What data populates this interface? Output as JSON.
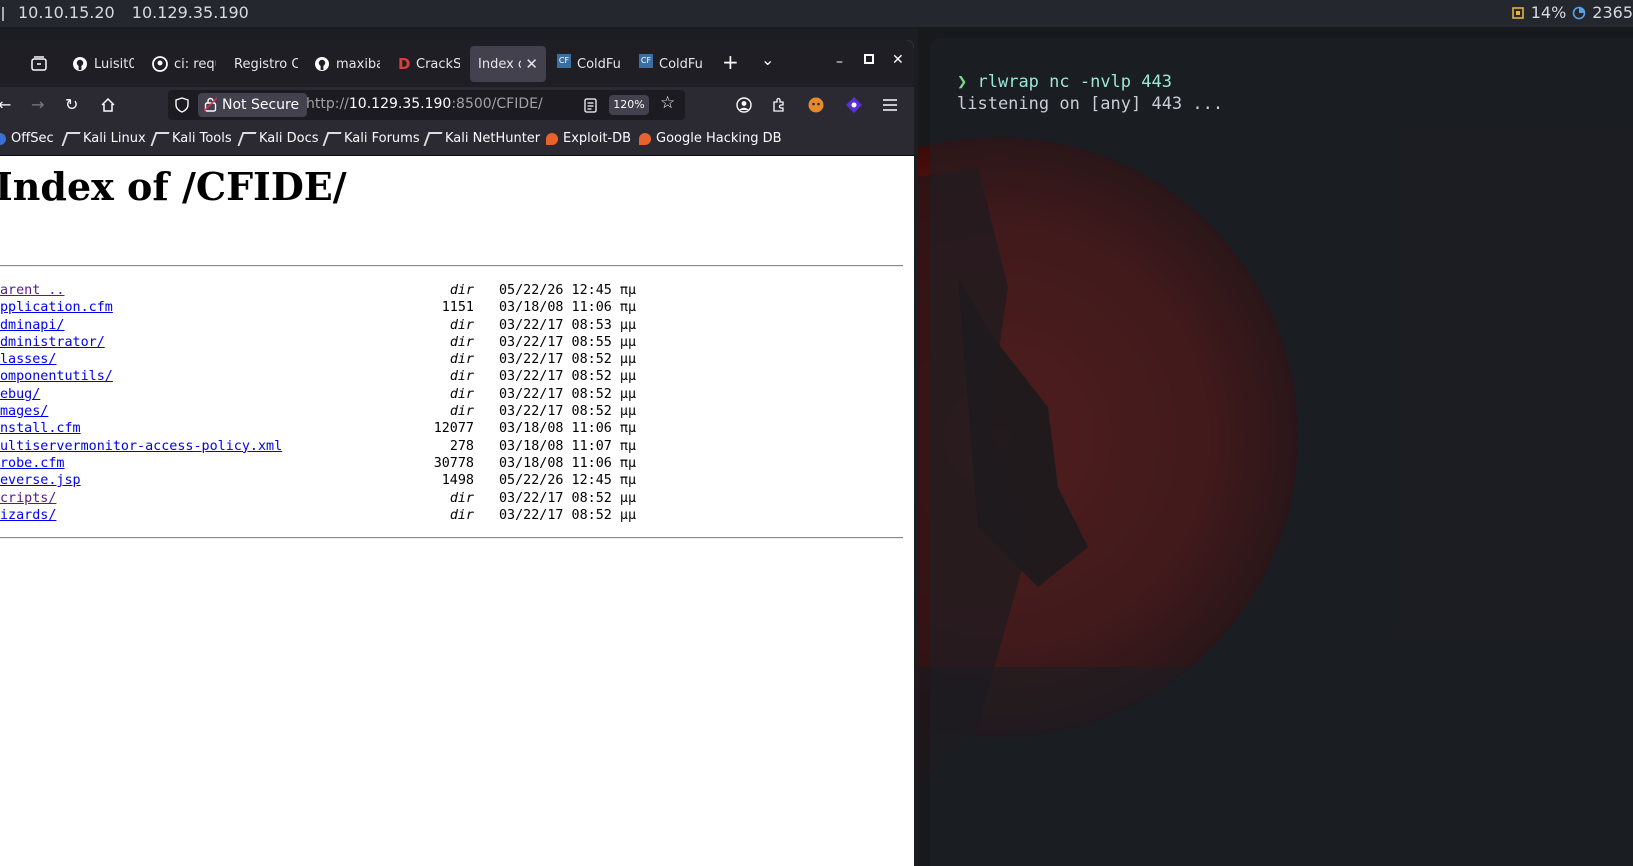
{
  "sysbar": {
    "ip_local": "10.10.15.20",
    "ip_target": "10.129.35.190",
    "cpu": "14%",
    "mem": "2365"
  },
  "terminal": {
    "prompt": "❯",
    "command": "rlwrap nc -nvlp 443",
    "output": "listening on [any] 443 ..."
  },
  "browser": {
    "tabs": [
      {
        "label": "Luisit0",
        "icon": "github-icon"
      },
      {
        "label": "ci: requ",
        "icon": "github-icon"
      },
      {
        "label": "Registro C",
        "icon": "none"
      },
      {
        "label": "maxiba",
        "icon": "github-icon"
      },
      {
        "label": "CrackS",
        "icon": "d-icon"
      },
      {
        "label": "Index o",
        "icon": "none",
        "active": true
      },
      {
        "label": "ColdFu",
        "icon": "cf-icon"
      },
      {
        "label": "ColdFu",
        "icon": "cf-icon"
      }
    ],
    "security_label": "Not Secure",
    "url_prefix": "http://",
    "url_host": "10.129.35.190",
    "url_rest": ":8500/CFIDE/",
    "zoom": "120%",
    "bookmarks": [
      "OffSec",
      "Kali Linux",
      "Kali Tools",
      "Kali Docs",
      "Kali Forums",
      "Kali NetHunter",
      "Exploit-DB",
      "Google Hacking DB"
    ]
  },
  "page": {
    "title": "Index of /CFIDE/",
    "entries": [
      {
        "name": "arent ..",
        "size": "dir",
        "date": "05/22/26 12:45 πμ",
        "visited": true
      },
      {
        "name": "pplication.cfm",
        "size": "1151",
        "date": "03/18/08 11:06 πμ"
      },
      {
        "name": "dminapi/",
        "size": "dir",
        "date": "03/22/17 08:53 μμ"
      },
      {
        "name": "dministrator/",
        "size": "dir",
        "date": "03/22/17 08:55 μμ"
      },
      {
        "name": "lasses/",
        "size": "dir",
        "date": "03/22/17 08:52 μμ"
      },
      {
        "name": "omponentutils/",
        "size": "dir",
        "date": "03/22/17 08:52 μμ"
      },
      {
        "name": "ebug/",
        "size": "dir",
        "date": "03/22/17 08:52 μμ"
      },
      {
        "name": "mages/",
        "size": "dir",
        "date": "03/22/17 08:52 μμ"
      },
      {
        "name": "nstall.cfm",
        "size": "12077",
        "date": "03/18/08 11:06 πμ"
      },
      {
        "name": "ultiservermonitor-access-policy.xml",
        "size": "278",
        "date": "03/18/08 11:07 πμ"
      },
      {
        "name": "robe.cfm",
        "size": "30778",
        "date": "03/18/08 11:06 πμ"
      },
      {
        "name": "everse.jsp",
        "size": "1498",
        "date": "05/22/26 12:45 πμ"
      },
      {
        "name": "cripts/",
        "size": "dir",
        "date": "03/22/17 08:52 μμ",
        "visited": true
      },
      {
        "name": "izards/",
        "size": "dir",
        "date": "03/22/17 08:52 μμ"
      }
    ]
  }
}
